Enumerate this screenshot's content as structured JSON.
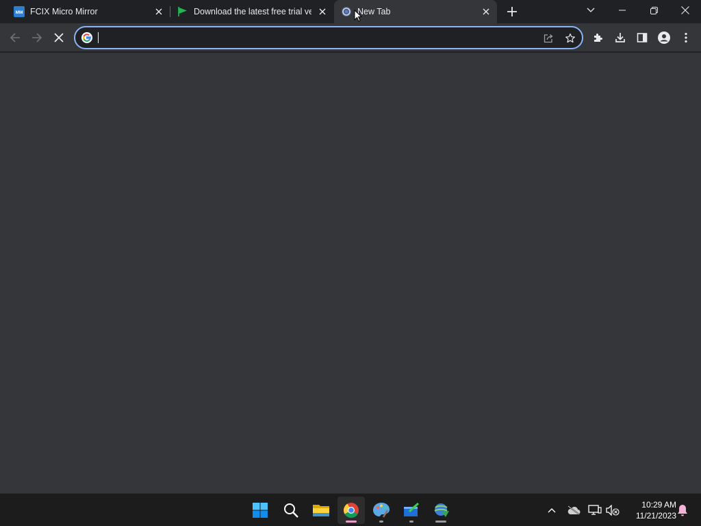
{
  "browser": {
    "tabs": [
      {
        "title": "FCIX Micro Mirror",
        "favicon": "fcix-mm-icon",
        "active": false
      },
      {
        "title": "Download the latest free trial ver",
        "favicon": "green-flag-icon",
        "active": false
      },
      {
        "title": "New Tab",
        "favicon": "chrome-newtab-icon",
        "active": true
      }
    ],
    "omnibox": {
      "value": "",
      "placeholder": ""
    },
    "colors": {
      "frame": "#202124",
      "toolbar": "#35363a",
      "focus_ring": "#8ab4f8",
      "text": "#e8eaed"
    }
  },
  "taskbar": {
    "apps": [
      {
        "name": "windows-start-icon"
      },
      {
        "name": "search-icon"
      },
      {
        "name": "file-explorer-icon"
      },
      {
        "name": "chrome-icon",
        "active": true
      },
      {
        "name": "paint-app-icon"
      },
      {
        "name": "app-window-icon"
      },
      {
        "name": "internet-download-manager-icon"
      }
    ],
    "clock": {
      "time": "10:29 AM",
      "date": "11/21/2023"
    }
  }
}
